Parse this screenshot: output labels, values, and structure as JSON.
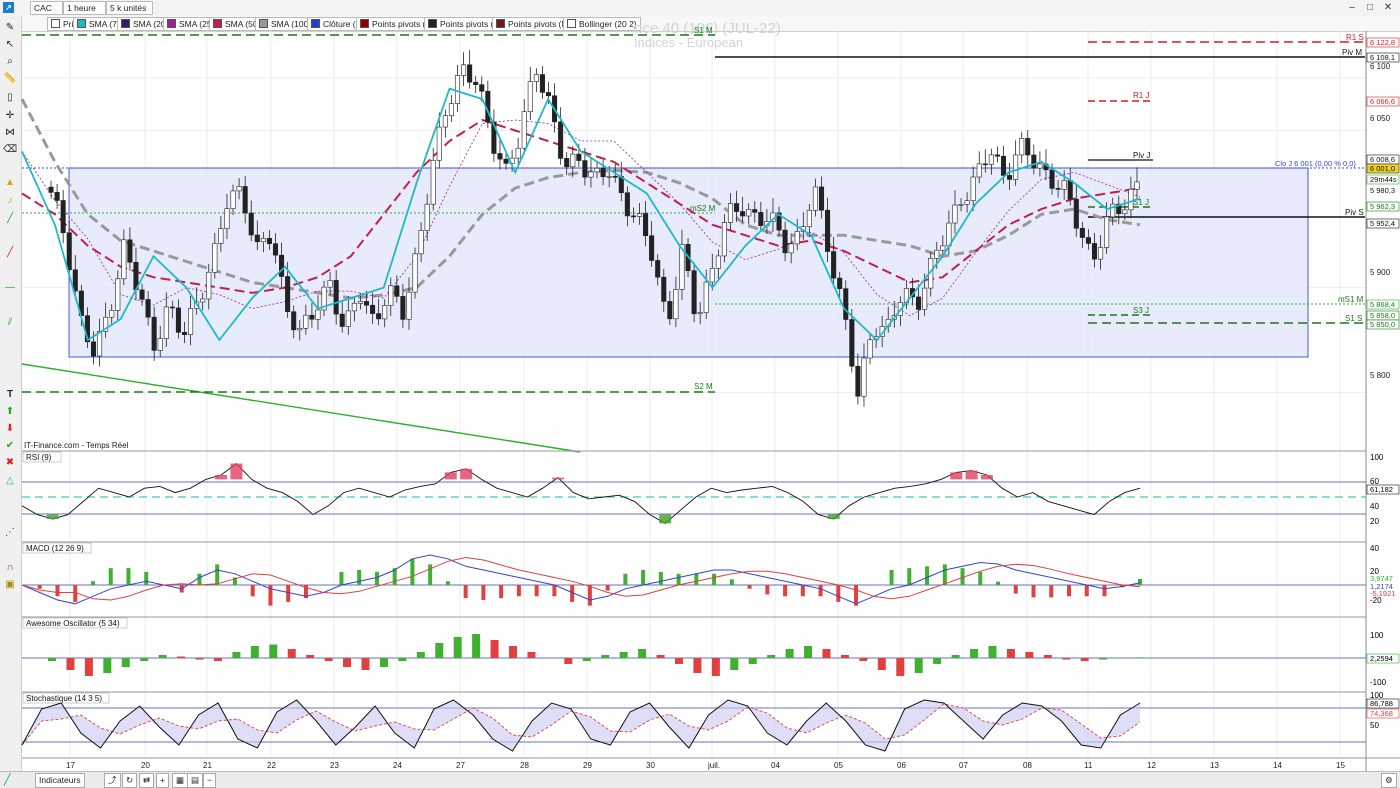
{
  "window": {
    "symbol": "CAC",
    "interval": "1 heure",
    "units": "5 k unités"
  },
  "toolbar": {
    "items": [
      {
        "label": "Prix",
        "color": "#ffffff"
      },
      {
        "label": "SMA (7)",
        "color": "#20b8c8"
      },
      {
        "label": "SMA (20)",
        "color": "#3a1a6a"
      },
      {
        "label": "SMA (25)",
        "color": "#a020a0"
      },
      {
        "label": "SMA (50)",
        "color": "#c0204a"
      },
      {
        "label": "SMA (100)",
        "color": "#999999"
      },
      {
        "label": "Clôture (J)",
        "color": "#2040d0"
      },
      {
        "label": "Points pivots (J)",
        "color": "#8b0000"
      },
      {
        "label": "Points pivots (S)",
        "color": "#222222"
      },
      {
        "label": "Points pivots (M)",
        "color": "#6a1a1a"
      },
      {
        "label": "Bollinger (20 2)",
        "color": "#ffffff"
      }
    ]
  },
  "watermark": {
    "line1": "nce 40 (10€) (JUL-22)",
    "line2": "Indices - European"
  },
  "source": "IT-Finance.com - Temps Réel",
  "panels": {
    "rsi": "RSI (9)",
    "macd": "MACD (12 26 9)",
    "ao": "Awesome Oscillator (5 34)",
    "stoch": "Stochastique (14 3 5)"
  },
  "bottom": {
    "indicators_label": "Indicateurs"
  },
  "chart_data": [
    {
      "type": "candlestick",
      "x_labels": [
        "17",
        "20",
        "21",
        "22",
        "23",
        "24",
        "27",
        "28",
        "29",
        "30",
        "juil.",
        "04",
        "05",
        "06",
        "07",
        "08",
        "11",
        "12",
        "13",
        "14",
        "15"
      ],
      "y_ticks": [
        "6 100",
        "6 050",
        "5 900",
        "5 800"
      ],
      "ylim": [
        5745,
        6145
      ],
      "close_path": [
        5985,
        5950,
        5870,
        5830,
        5885,
        5940,
        5890,
        5850,
        5880,
        5850,
        5895,
        5920,
        5980,
        6000,
        5930,
        5950,
        5890,
        5850,
        5880,
        5910,
        5850,
        5900,
        5870,
        5890,
        5880,
        5940,
        6010,
        6080,
        6110,
        6090,
        6050,
        6010,
        6040,
        6120,
        6070,
        6010,
        6030,
        6000,
        6010,
        5990,
        5960,
        5930,
        5870,
        5930,
        5870,
        5920,
        5960,
        5980,
        5970,
        5960,
        5945,
        5950,
        5990,
        5940,
        5880,
        5790,
        5870,
        5860,
        5890,
        5890,
        5920,
        5950,
        5990,
        6000,
        6030,
        6010,
        6030,
        6020,
        6010,
        5990,
        5960,
        5930,
        5960,
        5980,
        6001
      ],
      "sma100_path": [
        6080,
        6020,
        5970,
        5945,
        5935,
        5925,
        5915,
        5905,
        5900,
        5895,
        5890,
        5893,
        5900,
        5930,
        5970,
        5995,
        6005,
        6010,
        6012,
        6010,
        6000,
        5985,
        5960,
        5950,
        5950,
        5950,
        5945,
        5940,
        5930,
        5935,
        5950,
        5970,
        5975,
        5965,
        5960
      ],
      "sma50_path": [
        5990,
        5970,
        5940,
        5920,
        5910,
        5905,
        5900,
        5895,
        5900,
        5910,
        5930,
        5970,
        6010,
        6040,
        6060,
        6050,
        6040,
        6030,
        6020,
        6000,
        5980,
        5960,
        5950,
        5940,
        5945,
        5935,
        5920,
        5905,
        5910,
        5935,
        5960,
        5975,
        5985,
        5990,
        5995
      ],
      "sma7_path": [
        6030,
        5960,
        5850,
        5870,
        5930,
        5900,
        5850,
        5890,
        5920,
        5880,
        5890,
        5900,
        6000,
        6090,
        6080,
        6010,
        6080,
        6030,
        6010,
        5990,
        5940,
        5900,
        5940,
        5970,
        5950,
        5880,
        5850,
        5890,
        5930,
        5980,
        6010,
        6020,
        6000,
        5975,
        5985
      ],
      "pivot_levels": [
        {
          "label": "R1 S",
          "value": "6 122,8"
        },
        {
          "label": "Piv M",
          "value": "6 108,1"
        },
        {
          "label": "R1 J",
          "value": "6 066,6"
        },
        {
          "label": "Piv J",
          "value": "6 008,6"
        },
        {
          "label": "S1 J",
          "value": "5 962,3"
        },
        {
          "label": "Piv S",
          "value": "5 952,4"
        },
        {
          "label": "mS1 M",
          "value": "5 868,4"
        },
        {
          "label": "S3 J",
          "value": "5 858,0"
        },
        {
          "label": "S1 S",
          "value": "5 850,0"
        },
        {
          "label": "S1 M",
          "value": ""
        },
        {
          "label": "S2 M",
          "value": ""
        },
        {
          "label": "mS2 M",
          "value": ""
        }
      ],
      "price_tags": [
        "6 001,0",
        "29m44s",
        "5 980,3"
      ],
      "annotations": [
        "Clo J 6 001 (0,00 % 0,0)"
      ]
    },
    {
      "type": "line",
      "name": "RSI (9)",
      "y_ticks": [
        "100",
        "60",
        "40",
        "20"
      ],
      "last_value": "61,182",
      "values": [
        40,
        30,
        25,
        30,
        45,
        60,
        55,
        50,
        60,
        62,
        55,
        60,
        70,
        75,
        88,
        70,
        60,
        55,
        45,
        30,
        40,
        55,
        60,
        55,
        50,
        58,
        62,
        65,
        78,
        82,
        70,
        60,
        55,
        50,
        60,
        72,
        55,
        48,
        50,
        52,
        45,
        30,
        20,
        35,
        50,
        60,
        55,
        58,
        60,
        62,
        55,
        45,
        30,
        25,
        40,
        50,
        55,
        60,
        62,
        65,
        70,
        78,
        80,
        75,
        60,
        50,
        55,
        45,
        40,
        35,
        30,
        45,
        55,
        60
      ]
    },
    {
      "type": "line",
      "name": "MACD (12 26 9)",
      "y_ticks": [
        "40",
        "20",
        "-20"
      ],
      "values_labels": [
        "3,9747",
        "1,2174",
        "-5,1921"
      ],
      "macd": [
        0,
        -10,
        -20,
        -25,
        -15,
        -5,
        0,
        5,
        0,
        -5,
        10,
        20,
        15,
        5,
        -5,
        -10,
        -15,
        -10,
        0,
        5,
        10,
        20,
        35,
        40,
        35,
        25,
        20,
        15,
        10,
        5,
        0,
        -10,
        -20,
        -15,
        -5,
        0,
        5,
        10,
        15,
        20,
        20,
        15,
        10,
        5,
        0,
        -5,
        -15,
        -25,
        -15,
        -5,
        0,
        10,
        20,
        25,
        30,
        28,
        20,
        15,
        10,
        5,
        0,
        -5,
        -2,
        3
      ]
    },
    {
      "type": "bar",
      "name": "Awesome Oscillator (5 34)",
      "y_ticks": [
        "100",
        "-100"
      ],
      "last_value": "2,2594",
      "values": [
        -10,
        -40,
        -60,
        -50,
        -30,
        -10,
        10,
        5,
        -5,
        -10,
        20,
        40,
        45,
        30,
        10,
        -10,
        -30,
        -40,
        -30,
        -10,
        20,
        50,
        70,
        80,
        60,
        40,
        20,
        0,
        -20,
        -10,
        10,
        20,
        30,
        10,
        -20,
        -50,
        -60,
        -40,
        -20,
        10,
        30,
        40,
        30,
        10,
        -10,
        -40,
        -60,
        -50,
        -20,
        10,
        30,
        40,
        30,
        20,
        10,
        -5,
        -10,
        -5,
        0,
        2
      ]
    },
    {
      "type": "line",
      "name": "Stochastique (14 3 5)",
      "y_ticks": [
        "50"
      ],
      "values_labels": [
        "86,788",
        "74,368"
      ],
      "k": [
        20,
        80,
        90,
        40,
        15,
        60,
        85,
        50,
        20,
        70,
        90,
        30,
        15,
        75,
        95,
        60,
        20,
        50,
        85,
        40,
        15,
        80,
        95,
        70,
        30,
        10,
        60,
        90,
        80,
        30,
        20,
        75,
        90,
        50,
        15,
        70,
        95,
        85,
        40,
        20,
        60,
        90,
        60,
        20,
        10,
        80,
        95,
        90,
        60,
        30,
        70,
        90,
        85,
        60,
        20,
        15,
        70,
        90
      ]
    }
  ]
}
